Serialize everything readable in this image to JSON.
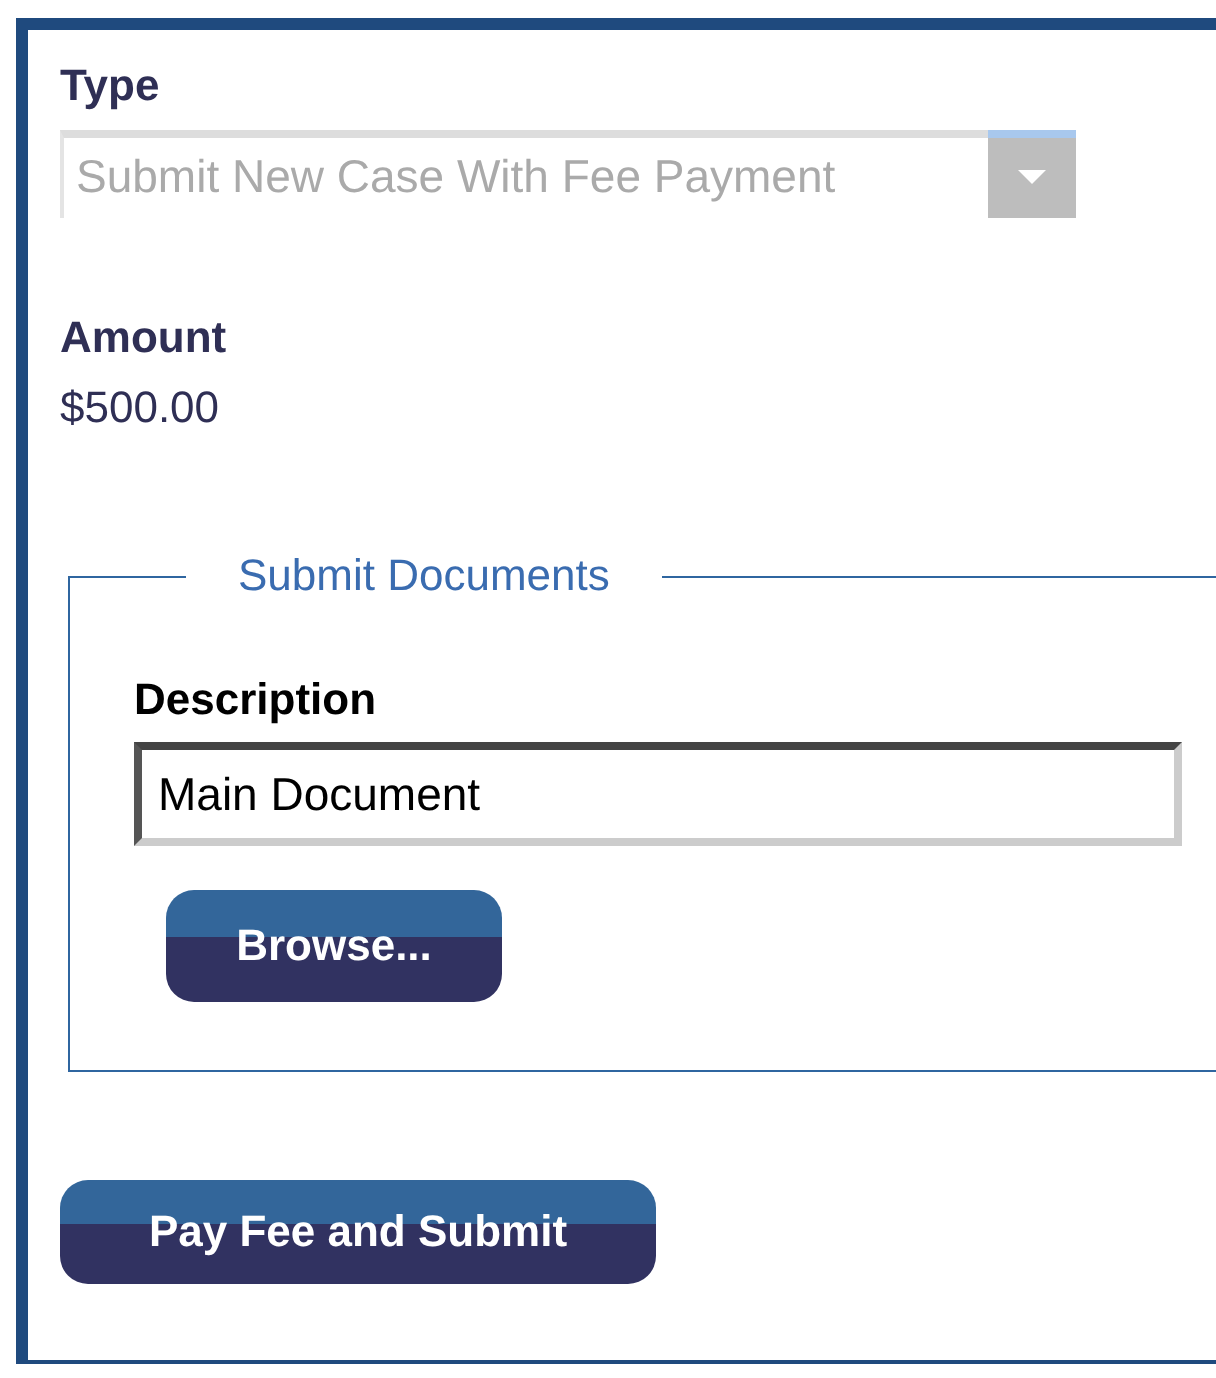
{
  "type_field": {
    "label": "Type",
    "value": "Submit New Case With Fee Payment",
    "disabled": true
  },
  "amount": {
    "label": "Amount",
    "value": "$500.00"
  },
  "documents": {
    "legend": "Submit Documents",
    "description_label": "Description",
    "description_value": "Main Document",
    "browse_button": "Browse..."
  },
  "submit_button": "Pay Fee and Submit"
}
